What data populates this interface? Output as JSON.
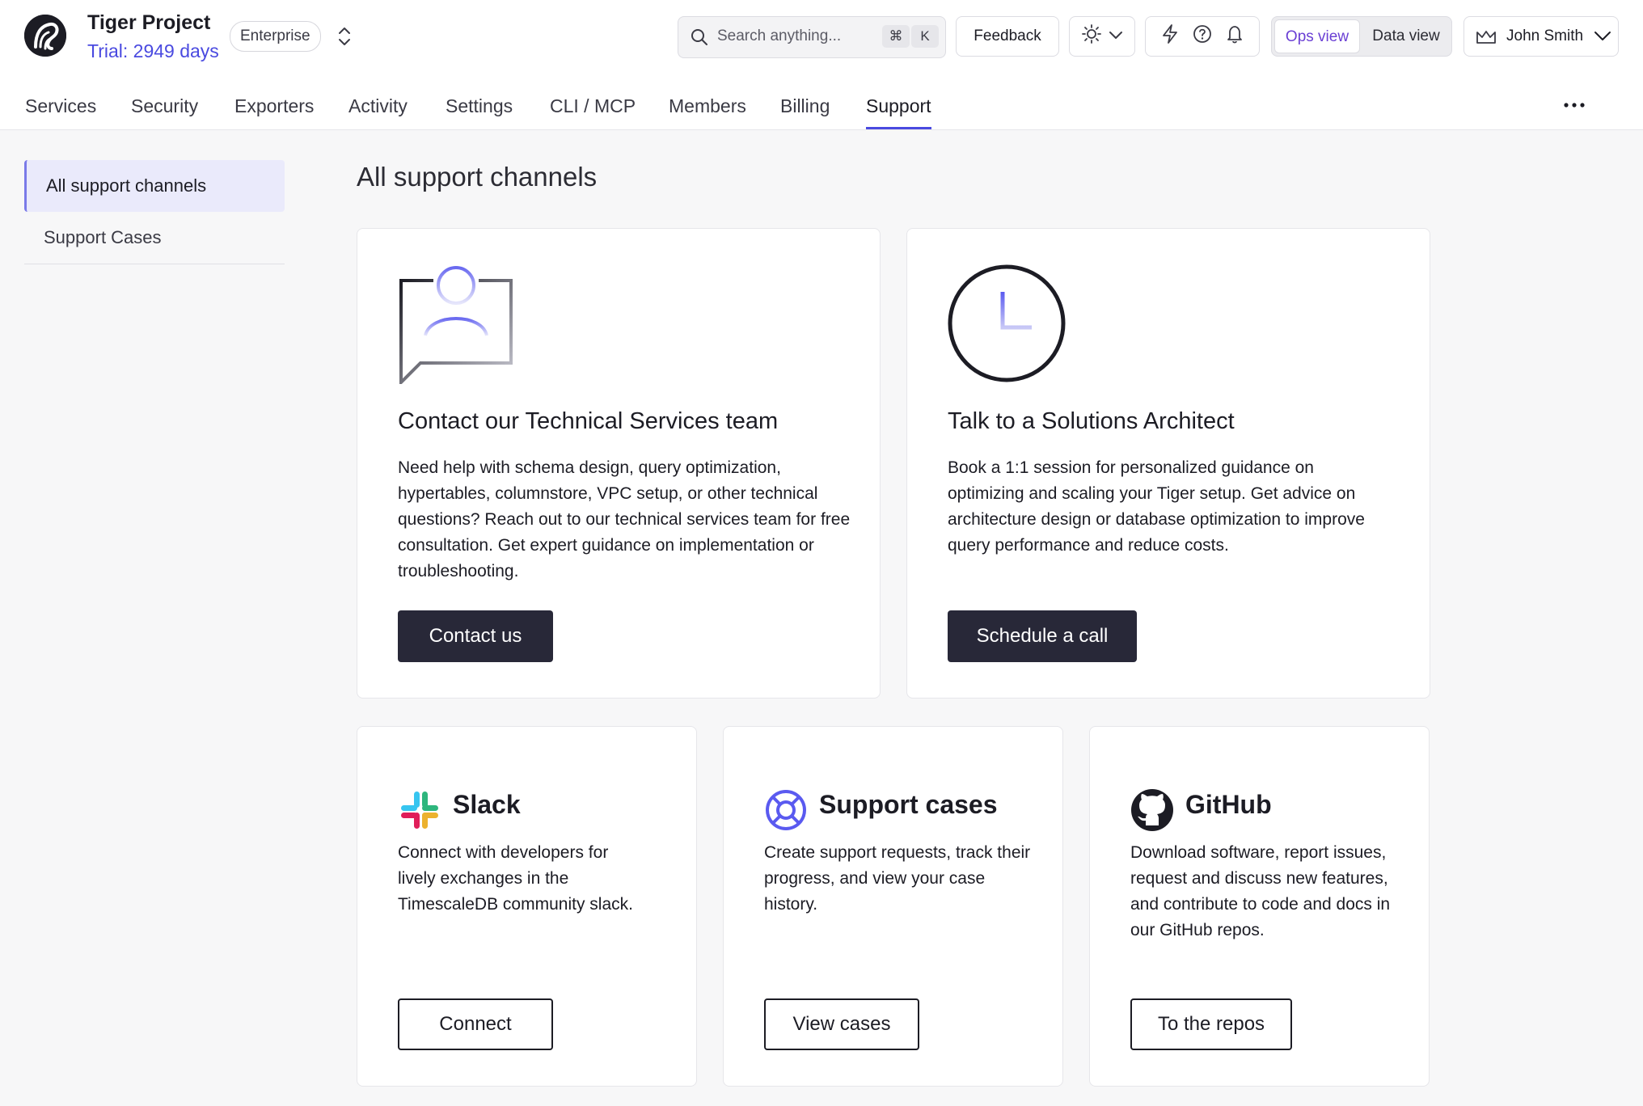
{
  "header": {
    "project_name": "Tiger Project",
    "trial_text": "Trial: 2949 days",
    "plan_badge": "Enterprise",
    "search_placeholder": "Search anything...",
    "search_shortcut_cmd": "⌘",
    "search_shortcut_key": "K",
    "feedback_label": "Feedback",
    "views": [
      "Ops view",
      "Data view"
    ],
    "active_view": "Ops view",
    "user_name": "John Smith",
    "accent_color": "#4a4ae0"
  },
  "nav": {
    "tabs": [
      "Services",
      "Security",
      "Exporters",
      "Activity",
      "Settings",
      "CLI / MCP",
      "Members",
      "Billing",
      "Support"
    ],
    "active_tab": "Support"
  },
  "sidebar": {
    "items": [
      "All support channels",
      "Support Cases"
    ],
    "active_item": "All support channels"
  },
  "main": {
    "page_title": "All support channels",
    "featured_cards": [
      {
        "icon": "contact-person-icon",
        "title": "Contact our Technical Services team",
        "description": "Need help with schema design, query optimization, hypertables, columnstore, VPC setup, or other technical questions? Reach out to our technical services team for free consultation. Get expert guidance on implementation or troubleshooting.",
        "button_label": "Contact us"
      },
      {
        "icon": "clock-icon",
        "title": "Talk to a Solutions Architect",
        "description": "Book a 1:1 session for personalized guidance on optimizing and scaling your Tiger setup. Get advice on architecture design or database optimization to improve query performance and reduce costs.",
        "button_label": "Schedule a call"
      }
    ],
    "channel_cards": [
      {
        "icon": "slack-icon",
        "title": "Slack",
        "description": "Connect with developers for lively exchanges in the TimescaleDB community slack.",
        "button_label": "Connect"
      },
      {
        "icon": "lifebuoy-icon",
        "title": "Support cases",
        "description": "Create support requests, track their progress, and view your case history.",
        "button_label": "View cases"
      },
      {
        "icon": "github-icon",
        "title": "GitHub",
        "description": "Download software, report issues, request and discuss new features, and contribute to code and docs in our GitHub repos.",
        "button_label": "To the repos"
      }
    ]
  }
}
